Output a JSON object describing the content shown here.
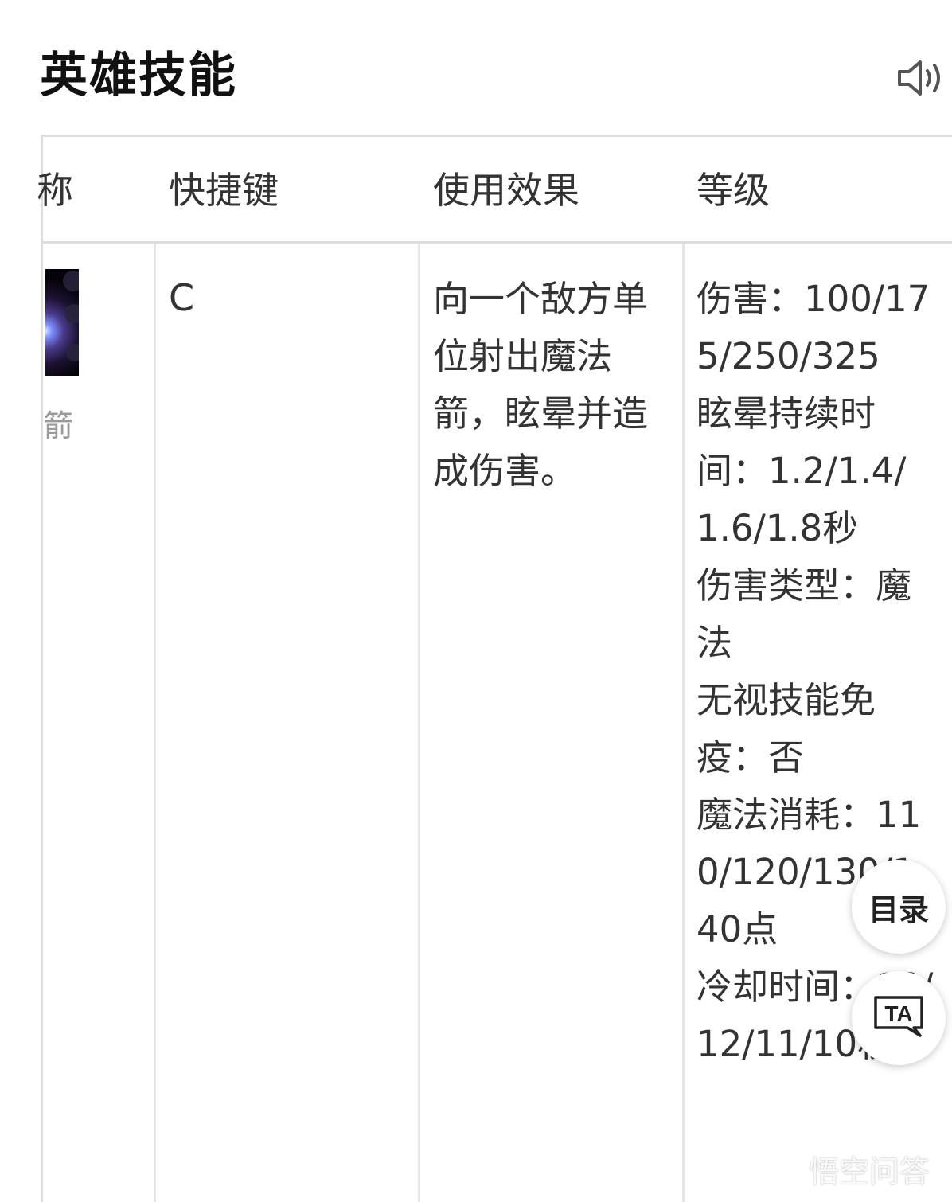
{
  "section": {
    "title": "英雄技能"
  },
  "icons": {
    "speaker": "speaker-icon",
    "translate": "translate-icon",
    "watermark_logo": "wukong-logo-icon"
  },
  "table": {
    "headers": {
      "name_fragment": "称",
      "hotkey": "快捷键",
      "effect": "使用效果",
      "level": "等级"
    },
    "row": {
      "name_fragment": "箭",
      "hotkey": "C",
      "effect": "向一个敌方单位射出魔法箭，眩晕并造成伤害。",
      "level": "伤害：100/175/250/325\n眩晕持续时间：1.2/1.4/1.6/1.8秒\n伤害类型：魔法\n无视技能免疫：否\n魔法消耗：110/120/130/140点\n冷却时间：13/12/11/10秒"
    }
  },
  "floating": {
    "toc_label": "目录",
    "translate_label": "TA"
  },
  "watermark": {
    "text": "悟空问答"
  }
}
